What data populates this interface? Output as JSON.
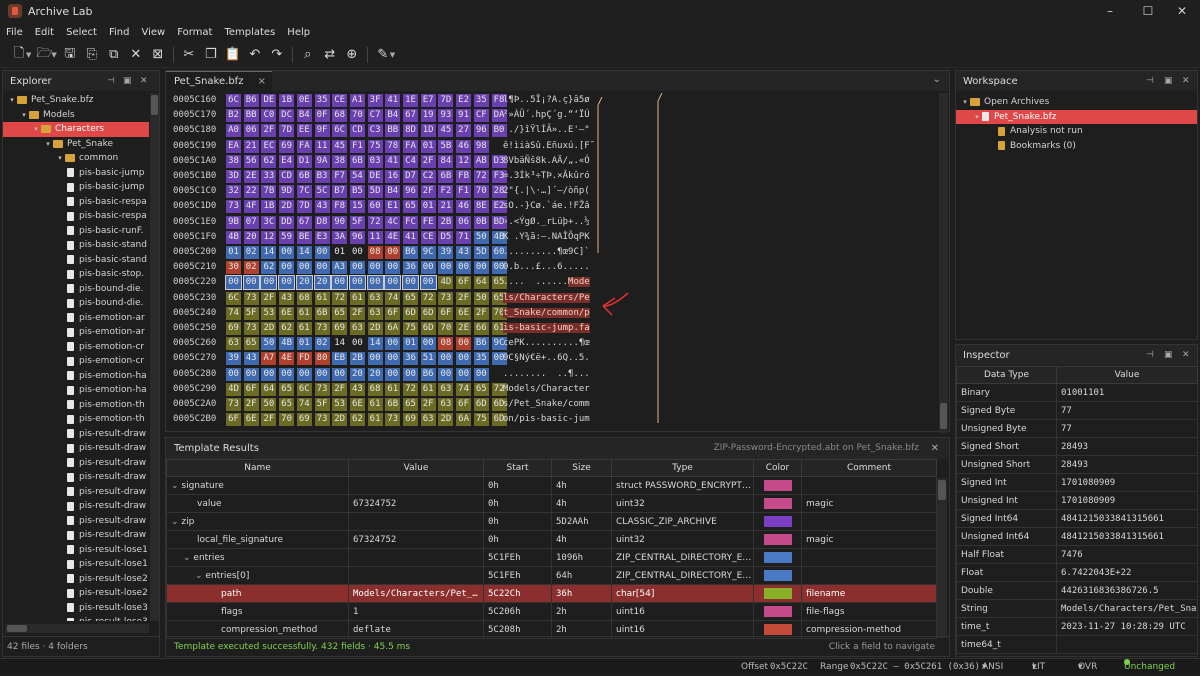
{
  "app": {
    "title": "Archive Lab",
    "minimize": "–",
    "maximize": "☐",
    "close": "✕"
  },
  "menu": [
    "File",
    "Edit",
    "Select",
    "Find",
    "View",
    "Format",
    "Templates",
    "Help"
  ],
  "explorer": {
    "title": "Explorer",
    "footer": "42 files · 4 folders",
    "items": [
      {
        "label": "Pet_Snake.bfz",
        "type": "archive",
        "depth": 0,
        "expanded": true
      },
      {
        "label": "Models",
        "type": "folder",
        "depth": 1,
        "expanded": true
      },
      {
        "label": "Characters",
        "type": "folder",
        "depth": 2,
        "expanded": true,
        "selected": true
      },
      {
        "label": "Pet_Snake",
        "type": "folder",
        "depth": 3,
        "expanded": true
      },
      {
        "label": "common",
        "type": "folder",
        "depth": 4,
        "expanded": true
      },
      {
        "label": "pis-basic-jump",
        "type": "file",
        "depth": 5
      },
      {
        "label": "pis-basic-jump",
        "type": "file",
        "depth": 5
      },
      {
        "label": "pis-basic-respa",
        "type": "file",
        "depth": 5
      },
      {
        "label": "pis-basic-respa",
        "type": "file",
        "depth": 5
      },
      {
        "label": "pis-basic-runF.",
        "type": "file",
        "depth": 5
      },
      {
        "label": "pis-basic-stand",
        "type": "file",
        "depth": 5
      },
      {
        "label": "pis-basic-stand",
        "type": "file",
        "depth": 5
      },
      {
        "label": "pis-basic-stop.",
        "type": "file",
        "depth": 5
      },
      {
        "label": "pis-bound-die.",
        "type": "file",
        "depth": 5
      },
      {
        "label": "pis-bound-die.",
        "type": "file",
        "depth": 5
      },
      {
        "label": "pis-emotion-ar",
        "type": "file",
        "depth": 5
      },
      {
        "label": "pis-emotion-ar",
        "type": "file",
        "depth": 5
      },
      {
        "label": "pis-emotion-cr",
        "type": "file",
        "depth": 5
      },
      {
        "label": "pis-emotion-cr",
        "type": "file",
        "depth": 5
      },
      {
        "label": "pis-emotion-ha",
        "type": "file",
        "depth": 5
      },
      {
        "label": "pis-emotion-ha",
        "type": "file",
        "depth": 5
      },
      {
        "label": "pis-emotion-th",
        "type": "file",
        "depth": 5
      },
      {
        "label": "pis-emotion-th",
        "type": "file",
        "depth": 5
      },
      {
        "label": "pis-result-draw",
        "type": "file",
        "depth": 5
      },
      {
        "label": "pis-result-draw",
        "type": "file",
        "depth": 5
      },
      {
        "label": "pis-result-draw",
        "type": "file",
        "depth": 5
      },
      {
        "label": "pis-result-draw",
        "type": "file",
        "depth": 5
      },
      {
        "label": "pis-result-draw",
        "type": "file",
        "depth": 5
      },
      {
        "label": "pis-result-draw",
        "type": "file",
        "depth": 5
      },
      {
        "label": "pis-result-draw",
        "type": "file",
        "depth": 5
      },
      {
        "label": "pis-result-draw",
        "type": "file",
        "depth": 5
      },
      {
        "label": "pis-result-lose1",
        "type": "file",
        "depth": 5
      },
      {
        "label": "pis-result-lose1",
        "type": "file",
        "depth": 5
      },
      {
        "label": "pis-result-lose2",
        "type": "file",
        "depth": 5
      },
      {
        "label": "pis-result-lose2",
        "type": "file",
        "depth": 5
      },
      {
        "label": "pis-result-lose3",
        "type": "file",
        "depth": 5
      },
      {
        "label": "pis-result-lose3",
        "type": "file",
        "depth": 5
      }
    ]
  },
  "editor": {
    "tab": "Pet_Snake.bfz",
    "tab_close": "×",
    "rows": [
      {
        "offset": "0005C160",
        "bytes": [
          "6C",
          "B6",
          "DE",
          "1B",
          "0E",
          "35",
          "CE",
          "A1",
          "3F",
          "41",
          "1E",
          "E7",
          "7D",
          "E2",
          "35",
          "F8"
        ],
        "ascii": "l¶Þ..5Î¡?A.ç}â5ø"
      },
      {
        "offset": "0005C170",
        "bytes": [
          "B2",
          "BB",
          "C0",
          "DC",
          "B4",
          "0F",
          "68",
          "70",
          "C7",
          "B4",
          "67",
          "19",
          "93",
          "91",
          "CF",
          "DA"
        ],
        "ascii": "²»ÀÜ´.hpÇ´g.“‘ÏÚ"
      },
      {
        "offset": "0005C180",
        "bytes": [
          "A0",
          "06",
          "2F",
          "7D",
          "EE",
          "9F",
          "6C",
          "CD",
          "C3",
          "BB",
          "8D",
          "1D",
          "45",
          "27",
          "96",
          "B0"
        ],
        "ascii": " ./}îŸlÍÃ»..E'–°"
      },
      {
        "offset": "0005C190",
        "bytes": [
          "EA",
          "21",
          "EC",
          "69",
          "FA",
          "11",
          "45",
          "F1",
          "75",
          "78",
          "FA",
          "01",
          "5B",
          "46",
          "98"
        ],
        "ascii": "ê!ìiàSû.Eñuxú.[F˜"
      },
      {
        "offset": "0005C1A0",
        "bytes": [
          "38",
          "56",
          "62",
          "E4",
          "D1",
          "9A",
          "38",
          "6B",
          "03",
          "41",
          "C4",
          "2F",
          "84",
          "12",
          "AB",
          "D3"
        ],
        "ascii": "8VbäÑš8k.AÄ/„.«Ó"
      },
      {
        "offset": "0005C1B0",
        "bytes": [
          "3D",
          "2E",
          "33",
          "CD",
          "6B",
          "B3",
          "F7",
          "54",
          "DE",
          "16",
          "D7",
          "C2",
          "6B",
          "FB",
          "72",
          "F3"
        ],
        "ascii": "=.3Ík³÷TÞ.×Âkûró"
      },
      {
        "offset": "0005C1C0",
        "bytes": [
          "32",
          "22",
          "7B",
          "9D",
          "7C",
          "5C",
          "B7",
          "B5",
          "5D",
          "B4",
          "96",
          "2F",
          "F2",
          "F1",
          "70",
          "28"
        ],
        "ascii": "2\"{.|\\·…]´–/òñp("
      },
      {
        "offset": "0005C1D0",
        "bytes": [
          "73",
          "4F",
          "1B",
          "2D",
          "7D",
          "43",
          "F8",
          "15",
          "60",
          "E1",
          "65",
          "01",
          "21",
          "46",
          "8E",
          "E2"
        ],
        "ascii": "sO.-}Cø.`áe.!FŽâ"
      },
      {
        "offset": "0005C1E0",
        "bytes": [
          "9B",
          "07",
          "3C",
          "DD",
          "67",
          "D8",
          "90",
          "5F",
          "72",
          "4C",
          "FC",
          "FE",
          "2B",
          "06",
          "0B",
          "BD"
        ],
        "ascii": "›.<ÝgØ._rLüþ+..½"
      },
      {
        "offset": "0005C1F0",
        "bytes": [
          "4B",
          "20",
          "12",
          "59",
          "BE",
          "E3",
          "3A",
          "96",
          "11",
          "4E",
          "41",
          "CE",
          "D5",
          "71",
          "50",
          "4B"
        ],
        "ascii": "K .Y¾ã:–.NAÎÕqPK"
      },
      {
        "offset": "0005C200",
        "bytes": [
          "01",
          "02",
          "14",
          "00",
          "14",
          "00",
          "01",
          "00",
          "08",
          "00",
          "B6",
          "9C",
          "39",
          "43",
          "5D",
          "60"
        ],
        "ascii": "..........¶œ9C]`"
      },
      {
        "offset": "0005C210",
        "bytes": [
          "30",
          "02",
          "62",
          "00",
          "00",
          "00",
          "A3",
          "00",
          "00",
          "00",
          "36",
          "00",
          "00",
          "00",
          "00",
          "00"
        ],
        "ascii": "0.b...£...6....."
      },
      {
        "offset": "0005C220",
        "bytes": [
          "00",
          "00",
          "00",
          "00",
          "20",
          "20",
          "00",
          "00",
          "00",
          "00",
          "00",
          "00",
          "4D",
          "6F",
          "64",
          "65"
        ],
        "ascii": "....  ......Mode"
      },
      {
        "offset": "0005C230",
        "bytes": [
          "6C",
          "73",
          "2F",
          "43",
          "68",
          "61",
          "72",
          "61",
          "63",
          "74",
          "65",
          "72",
          "73",
          "2F",
          "50",
          "65"
        ],
        "ascii": "ls/Characters/Pe"
      },
      {
        "offset": "0005C240",
        "bytes": [
          "74",
          "5F",
          "53",
          "6E",
          "61",
          "6B",
          "65",
          "2F",
          "63",
          "6F",
          "6D",
          "6D",
          "6F",
          "6E",
          "2F",
          "70"
        ],
        "ascii": "t_Snake/common/p"
      },
      {
        "offset": "0005C250",
        "bytes": [
          "69",
          "73",
          "2D",
          "62",
          "61",
          "73",
          "69",
          "63",
          "2D",
          "6A",
          "75",
          "6D",
          "70",
          "2E",
          "66",
          "61"
        ],
        "ascii": "is-basic-jump.fa"
      },
      {
        "offset": "0005C260",
        "bytes": [
          "63",
          "65",
          "50",
          "4B",
          "01",
          "02",
          "14",
          "00",
          "14",
          "00",
          "01",
          "00",
          "08",
          "00",
          "B6",
          "9C"
        ],
        "ascii": "cePK..........¶œ"
      },
      {
        "offset": "0005C270",
        "bytes": [
          "39",
          "43",
          "A7",
          "4E",
          "FD",
          "80",
          "EB",
          "2B",
          "00",
          "00",
          "36",
          "51",
          "00",
          "00",
          "35",
          "00"
        ],
        "ascii": "9C§Ný€ë+..6Q..5."
      },
      {
        "offset": "0005C280",
        "bytes": [
          "00",
          "00",
          "00",
          "00",
          "00",
          "00",
          "00",
          "20",
          "20",
          "00",
          "00",
          "B6",
          "00",
          "00",
          "00"
        ],
        "ascii": "........  ..¶..."
      },
      {
        "offset": "0005C290",
        "bytes": [
          "4D",
          "6F",
          "64",
          "65",
          "6C",
          "73",
          "2F",
          "43",
          "68",
          "61",
          "72",
          "61",
          "63",
          "74",
          "65",
          "72"
        ],
        "ascii": "Models/Character"
      },
      {
        "offset": "0005C2A0",
        "bytes": [
          "73",
          "2F",
          "50",
          "65",
          "74",
          "5F",
          "53",
          "6E",
          "61",
          "6B",
          "65",
          "2F",
          "63",
          "6F",
          "6D",
          "6D"
        ],
        "ascii": "s/Pet_Snake/comm"
      },
      {
        "offset": "0005C2B0",
        "bytes": [
          "6F",
          "6E",
          "2F",
          "70",
          "69",
          "73",
          "2D",
          "62",
          "61",
          "73",
          "69",
          "63",
          "2D",
          "6A",
          "75",
          "6D"
        ],
        "ascii": "on/pis-basic-jum"
      }
    ]
  },
  "template": {
    "title": "Template Results",
    "source": "ZIP-Password-Encrypted.abt on Pet_Snake.bfz",
    "close": "✕",
    "columns": [
      "Name",
      "Value",
      "Start",
      "Size",
      "Type",
      "Color",
      "Comment"
    ],
    "rows": [
      {
        "name": "signature",
        "indent": 0,
        "expand": true,
        "value": "",
        "start": "0h",
        "size": "4h",
        "type": "struct PASSWORD_ENCRYPTED_ZII",
        "color": "#c44a8a",
        "comment": ""
      },
      {
        "name": "value",
        "indent": 1,
        "expand": false,
        "value": "67324752",
        "start": "0h",
        "size": "4h",
        "type": "uint32",
        "color": "#c44a8a",
        "comment": "magic"
      },
      {
        "name": "zip",
        "indent": 0,
        "expand": true,
        "value": "",
        "start": "0h",
        "size": "5D2AAh",
        "type": "CLASSIC_ZIP_ARCHIVE",
        "color": "#7b3fc4",
        "comment": ""
      },
      {
        "name": "local_file_signature",
        "indent": 1,
        "expand": false,
        "value": "67324752",
        "start": "0h",
        "size": "4h",
        "type": "uint32",
        "color": "#c44a8a",
        "comment": "magic"
      },
      {
        "name": "entries",
        "indent": 1,
        "expand": true,
        "value": "",
        "start": "5C1FEh",
        "size": "1096h",
        "type": "ZIP_CENTRAL_DIRECTORY_ENTRY[-",
        "color": "#4a7ac4",
        "comment": ""
      },
      {
        "name": "entries[0]",
        "indent": 2,
        "expand": true,
        "value": "",
        "start": "5C1FEh",
        "size": "64h",
        "type": "ZIP_CENTRAL_DIRECTORY_ENTRY",
        "color": "#4a7ac4",
        "comment": ""
      },
      {
        "name": "path",
        "indent": 3,
        "expand": false,
        "value": "Models/Characters/Pet_Sna…",
        "start": "5C22Ch",
        "size": "36h",
        "type": "char[54]",
        "color": "#8ab02a",
        "comment": "filename",
        "selected": true
      },
      {
        "name": "flags",
        "indent": 3,
        "expand": false,
        "value": "1",
        "start": "5C206h",
        "size": "2h",
        "type": "uint16",
        "color": "#c44a8a",
        "comment": "file-flags"
      },
      {
        "name": "compression_method",
        "indent": 3,
        "expand": false,
        "value": "deflate",
        "start": "5C208h",
        "size": "2h",
        "type": "uint16",
        "color": "#c44a3a",
        "comment": "compression-method"
      }
    ],
    "status": "Template executed successfully. 432 fields · 45.5 ms",
    "nav_hint": "Click a field to navigate"
  },
  "workspace": {
    "title": "Workspace",
    "items": [
      {
        "label": "Open Archives",
        "depth": 0
      },
      {
        "label": "Pet_Snake.bfz",
        "depth": 1,
        "selected": true
      },
      {
        "label": "Analysis not run",
        "depth": 2
      },
      {
        "label": "Bookmarks (0)",
        "depth": 2
      }
    ]
  },
  "inspector": {
    "title": "Inspector",
    "columns": [
      "Data Type",
      "Value"
    ],
    "rows": [
      {
        "type": "Binary",
        "value": "01001101"
      },
      {
        "type": "Signed Byte",
        "value": "77"
      },
      {
        "type": "Unsigned Byte",
        "value": "77"
      },
      {
        "type": "Signed Short",
        "value": "28493"
      },
      {
        "type": "Unsigned Short",
        "value": "28493"
      },
      {
        "type": "Signed Int",
        "value": "1701080909"
      },
      {
        "type": "Unsigned Int",
        "value": "1701080909"
      },
      {
        "type": "Signed Int64",
        "value": "4841215033841315661"
      },
      {
        "type": "Unsigned Int64",
        "value": "4841215033841315661"
      },
      {
        "type": "Half Float",
        "value": "7476"
      },
      {
        "type": "Float",
        "value": "6.7422043E+22"
      },
      {
        "type": "Double",
        "value": "4426316836386726.5"
      },
      {
        "type": "String",
        "value": "Models/Characters/Pet_Snake…"
      },
      {
        "type": "time_t",
        "value": "2023-11-27 10:28:29 UTC"
      },
      {
        "type": "time64_t",
        "value": ""
      }
    ]
  },
  "statusbar": {
    "offset_label": "Offset",
    "offset": "0x5C22C",
    "range_label": "Range",
    "range": "0x5C22C – 0x5C261 (0x36)",
    "encoding": "ANSI",
    "endian": "LIT",
    "mode": "OVR",
    "state": "Unchanged"
  },
  "colors": {
    "selection": "#e04848",
    "accent": "#7fd14a",
    "purple": "#7b3fc4",
    "blue": "#4a7ac4",
    "olive": "#8a8a2a",
    "red": "#c44a3a"
  }
}
